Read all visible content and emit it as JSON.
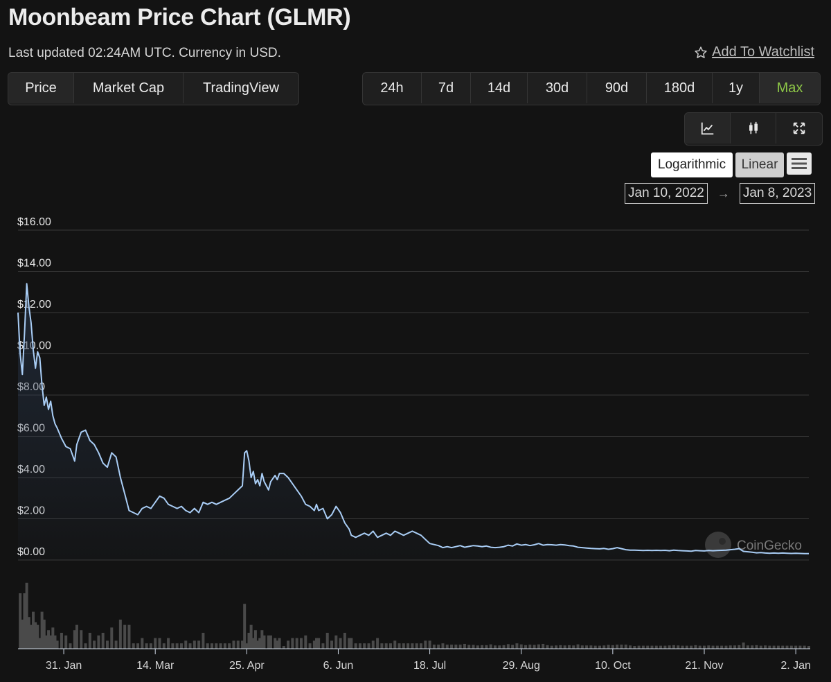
{
  "header": {
    "title": "Moonbeam Price Chart (GLMR)",
    "subtitle": "Last updated 02:24AM UTC. Currency in USD.",
    "watchlist_label": "Add To Watchlist"
  },
  "tabs": [
    {
      "label": "Price",
      "active": true
    },
    {
      "label": "Market Cap",
      "active": false
    },
    {
      "label": "TradingView",
      "active": false
    }
  ],
  "ranges": [
    {
      "label": "24h"
    },
    {
      "label": "7d"
    },
    {
      "label": "14d"
    },
    {
      "label": "30d"
    },
    {
      "label": "90d"
    },
    {
      "label": "180d"
    },
    {
      "label": "1y"
    },
    {
      "label": "Max",
      "active": true
    }
  ],
  "view_icons": [
    "line-chart-icon",
    "candlestick-icon",
    "fullscreen-icon"
  ],
  "scale": {
    "log_label": "Logarithmic",
    "linear_label": "Linear",
    "active": "Linear"
  },
  "date_range": {
    "from": "Jan 10, 2022",
    "to": "Jan 8, 2023",
    "arrow": "→"
  },
  "watermark": "CoinGecko",
  "colors": {
    "line": "#a9cdf5",
    "accent_max": "#8dc647",
    "background": "#131313"
  },
  "chart_data": {
    "type": "line",
    "ylim": [
      0,
      16
    ],
    "y_ticks": [
      "$0.00",
      "$2.00",
      "$4.00",
      "$6.00",
      "$8.00",
      "$10.00",
      "$12.00",
      "$14.00",
      "$16.00"
    ],
    "x_ticks": [
      "31. Jan",
      "14. Mar",
      "25. Apr",
      "6. Jun",
      "18. Jul",
      "29. Aug",
      "10. Oct",
      "21. Nov",
      "2. Jan"
    ],
    "x_tick_dates": [
      "2022-01-31",
      "2022-03-14",
      "2022-04-25",
      "2022-06-06",
      "2022-07-18",
      "2022-08-29",
      "2022-10-10",
      "2022-11-21",
      "2023-01-02"
    ],
    "x_range": [
      "2022-01-10",
      "2023-01-08"
    ],
    "series": [
      {
        "points": [
          [
            "2022-01-10",
            12.0
          ],
          [
            "2022-01-11",
            10.0
          ],
          [
            "2022-01-12",
            9.0
          ],
          [
            "2022-01-13",
            11.0
          ],
          [
            "2022-01-14",
            13.4
          ],
          [
            "2022-01-15",
            12.3
          ],
          [
            "2022-01-16",
            11.5
          ],
          [
            "2022-01-17",
            10.2
          ],
          [
            "2022-01-18",
            9.3
          ],
          [
            "2022-01-19",
            10.1
          ],
          [
            "2022-01-20",
            9.8
          ],
          [
            "2022-01-21",
            8.5
          ],
          [
            "2022-01-22",
            7.5
          ],
          [
            "2022-01-23",
            7.9
          ],
          [
            "2022-01-24",
            7.3
          ],
          [
            "2022-01-25",
            7.7
          ],
          [
            "2022-01-26",
            7.0
          ],
          [
            "2022-01-27",
            6.6
          ],
          [
            "2022-01-28",
            6.4
          ],
          [
            "2022-01-30",
            5.9
          ],
          [
            "2022-02-01",
            5.5
          ],
          [
            "2022-02-03",
            5.4
          ],
          [
            "2022-02-05",
            4.8
          ],
          [
            "2022-02-06",
            5.6
          ],
          [
            "2022-02-08",
            6.2
          ],
          [
            "2022-02-10",
            6.3
          ],
          [
            "2022-02-12",
            5.8
          ],
          [
            "2022-02-14",
            5.6
          ],
          [
            "2022-02-16",
            5.2
          ],
          [
            "2022-02-18",
            4.7
          ],
          [
            "2022-02-20",
            4.5
          ],
          [
            "2022-02-22",
            5.2
          ],
          [
            "2022-02-24",
            5.0
          ],
          [
            "2022-02-26",
            4.0
          ],
          [
            "2022-02-28",
            3.2
          ],
          [
            "2022-03-02",
            2.4
          ],
          [
            "2022-03-04",
            2.3
          ],
          [
            "2022-03-06",
            2.2
          ],
          [
            "2022-03-08",
            2.5
          ],
          [
            "2022-03-10",
            2.6
          ],
          [
            "2022-03-12",
            2.5
          ],
          [
            "2022-03-14",
            2.8
          ],
          [
            "2022-03-16",
            3.1
          ],
          [
            "2022-03-18",
            3.0
          ],
          [
            "2022-03-20",
            2.7
          ],
          [
            "2022-03-22",
            2.6
          ],
          [
            "2022-03-24",
            2.5
          ],
          [
            "2022-03-26",
            2.6
          ],
          [
            "2022-03-28",
            2.4
          ],
          [
            "2022-03-30",
            2.3
          ],
          [
            "2022-04-01",
            2.5
          ],
          [
            "2022-04-03",
            2.3
          ],
          [
            "2022-04-05",
            2.8
          ],
          [
            "2022-04-07",
            2.7
          ],
          [
            "2022-04-09",
            2.8
          ],
          [
            "2022-04-11",
            2.7
          ],
          [
            "2022-04-13",
            2.8
          ],
          [
            "2022-04-15",
            2.9
          ],
          [
            "2022-04-17",
            3.0
          ],
          [
            "2022-04-19",
            3.2
          ],
          [
            "2022-04-21",
            3.4
          ],
          [
            "2022-04-23",
            3.6
          ],
          [
            "2022-04-24",
            5.2
          ],
          [
            "2022-04-25",
            5.3
          ],
          [
            "2022-04-26",
            4.8
          ],
          [
            "2022-04-27",
            4.0
          ],
          [
            "2022-04-28",
            4.3
          ],
          [
            "2022-04-29",
            3.7
          ],
          [
            "2022-04-30",
            3.9
          ],
          [
            "2022-05-01",
            3.6
          ],
          [
            "2022-05-02",
            4.2
          ],
          [
            "2022-05-03",
            3.8
          ],
          [
            "2022-05-05",
            3.4
          ],
          [
            "2022-05-06",
            3.8
          ],
          [
            "2022-05-08",
            4.1
          ],
          [
            "2022-05-09",
            3.9
          ],
          [
            "2022-05-10",
            4.2
          ],
          [
            "2022-05-12",
            4.2
          ],
          [
            "2022-05-14",
            4.0
          ],
          [
            "2022-05-16",
            3.7
          ],
          [
            "2022-05-18",
            3.4
          ],
          [
            "2022-05-20",
            3.1
          ],
          [
            "2022-05-22",
            2.7
          ],
          [
            "2022-05-24",
            2.6
          ],
          [
            "2022-05-26",
            2.4
          ],
          [
            "2022-05-27",
            2.7
          ],
          [
            "2022-05-28",
            2.4
          ],
          [
            "2022-05-30",
            2.5
          ],
          [
            "2022-06-01",
            2.0
          ],
          [
            "2022-06-03",
            2.2
          ],
          [
            "2022-06-05",
            2.6
          ],
          [
            "2022-06-07",
            2.3
          ],
          [
            "2022-06-09",
            1.8
          ],
          [
            "2022-06-11",
            1.5
          ],
          [
            "2022-06-12",
            1.2
          ],
          [
            "2022-06-14",
            1.1
          ],
          [
            "2022-06-16",
            1.2
          ],
          [
            "2022-06-18",
            1.3
          ],
          [
            "2022-06-20",
            1.2
          ],
          [
            "2022-06-22",
            1.4
          ],
          [
            "2022-06-24",
            1.1
          ],
          [
            "2022-06-26",
            1.2
          ],
          [
            "2022-06-28",
            1.3
          ],
          [
            "2022-06-30",
            1.2
          ],
          [
            "2022-07-02",
            1.4
          ],
          [
            "2022-07-04",
            1.3
          ],
          [
            "2022-07-06",
            1.2
          ],
          [
            "2022-07-08",
            1.3
          ],
          [
            "2022-07-10",
            1.4
          ],
          [
            "2022-07-12",
            1.3
          ],
          [
            "2022-07-14",
            1.2
          ],
          [
            "2022-07-16",
            1.0
          ],
          [
            "2022-07-18",
            0.8
          ],
          [
            "2022-07-20",
            0.75
          ],
          [
            "2022-07-22",
            0.7
          ],
          [
            "2022-07-24",
            0.6
          ],
          [
            "2022-07-26",
            0.65
          ],
          [
            "2022-07-28",
            0.6
          ],
          [
            "2022-07-30",
            0.65
          ],
          [
            "2022-08-01",
            0.7
          ],
          [
            "2022-08-03",
            0.62
          ],
          [
            "2022-08-05",
            0.66
          ],
          [
            "2022-08-07",
            0.7
          ],
          [
            "2022-08-09",
            0.68
          ],
          [
            "2022-08-11",
            0.65
          ],
          [
            "2022-08-13",
            0.68
          ],
          [
            "2022-08-15",
            0.62
          ],
          [
            "2022-08-17",
            0.6
          ],
          [
            "2022-08-19",
            0.62
          ],
          [
            "2022-08-21",
            0.65
          ],
          [
            "2022-08-23",
            0.72
          ],
          [
            "2022-08-25",
            0.68
          ],
          [
            "2022-08-27",
            0.78
          ],
          [
            "2022-08-29",
            0.72
          ],
          [
            "2022-08-31",
            0.75
          ],
          [
            "2022-09-02",
            0.7
          ],
          [
            "2022-09-04",
            0.74
          ],
          [
            "2022-09-06",
            0.8
          ],
          [
            "2022-09-08",
            0.72
          ],
          [
            "2022-09-10",
            0.75
          ],
          [
            "2022-09-12",
            0.74
          ],
          [
            "2022-09-14",
            0.72
          ],
          [
            "2022-09-16",
            0.75
          ],
          [
            "2022-09-18",
            0.73
          ],
          [
            "2022-09-20",
            0.7
          ],
          [
            "2022-09-22",
            0.68
          ],
          [
            "2022-09-24",
            0.62
          ],
          [
            "2022-09-26",
            0.6
          ],
          [
            "2022-09-28",
            0.58
          ],
          [
            "2022-09-30",
            0.56
          ],
          [
            "2022-10-02",
            0.55
          ],
          [
            "2022-10-04",
            0.54
          ],
          [
            "2022-10-06",
            0.56
          ],
          [
            "2022-10-08",
            0.52
          ],
          [
            "2022-10-10",
            0.55
          ],
          [
            "2022-10-12",
            0.6
          ],
          [
            "2022-10-14",
            0.55
          ],
          [
            "2022-10-16",
            0.5
          ],
          [
            "2022-10-18",
            0.48
          ],
          [
            "2022-10-20",
            0.48
          ],
          [
            "2022-10-22",
            0.47
          ],
          [
            "2022-10-24",
            0.46
          ],
          [
            "2022-10-26",
            0.47
          ],
          [
            "2022-10-28",
            0.46
          ],
          [
            "2022-10-30",
            0.47
          ],
          [
            "2022-11-01",
            0.46
          ],
          [
            "2022-11-03",
            0.47
          ],
          [
            "2022-11-05",
            0.45
          ],
          [
            "2022-11-07",
            0.48
          ],
          [
            "2022-11-09",
            0.46
          ],
          [
            "2022-11-11",
            0.45
          ],
          [
            "2022-11-13",
            0.44
          ],
          [
            "2022-11-15",
            0.43
          ],
          [
            "2022-11-17",
            0.46
          ],
          [
            "2022-11-19",
            0.45
          ],
          [
            "2022-11-21",
            0.44
          ],
          [
            "2022-11-23",
            0.46
          ],
          [
            "2022-11-25",
            0.45
          ],
          [
            "2022-11-27",
            0.46
          ],
          [
            "2022-11-29",
            0.47
          ],
          [
            "2022-12-01",
            0.48
          ],
          [
            "2022-12-03",
            0.5
          ],
          [
            "2022-12-05",
            0.52
          ],
          [
            "2022-12-07",
            0.55
          ],
          [
            "2022-12-09",
            0.42
          ],
          [
            "2022-12-11",
            0.4
          ],
          [
            "2022-12-13",
            0.38
          ],
          [
            "2022-12-15",
            0.35
          ],
          [
            "2022-12-17",
            0.36
          ],
          [
            "2022-12-19",
            0.34
          ],
          [
            "2022-12-21",
            0.33
          ],
          [
            "2022-12-23",
            0.34
          ],
          [
            "2022-12-25",
            0.33
          ],
          [
            "2022-12-27",
            0.34
          ],
          [
            "2022-12-29",
            0.33
          ],
          [
            "2022-12-31",
            0.32
          ],
          [
            "2023-01-02",
            0.33
          ],
          [
            "2023-01-04",
            0.32
          ],
          [
            "2023-01-06",
            0.31
          ],
          [
            "2023-01-08",
            0.31
          ]
        ]
      }
    ]
  }
}
